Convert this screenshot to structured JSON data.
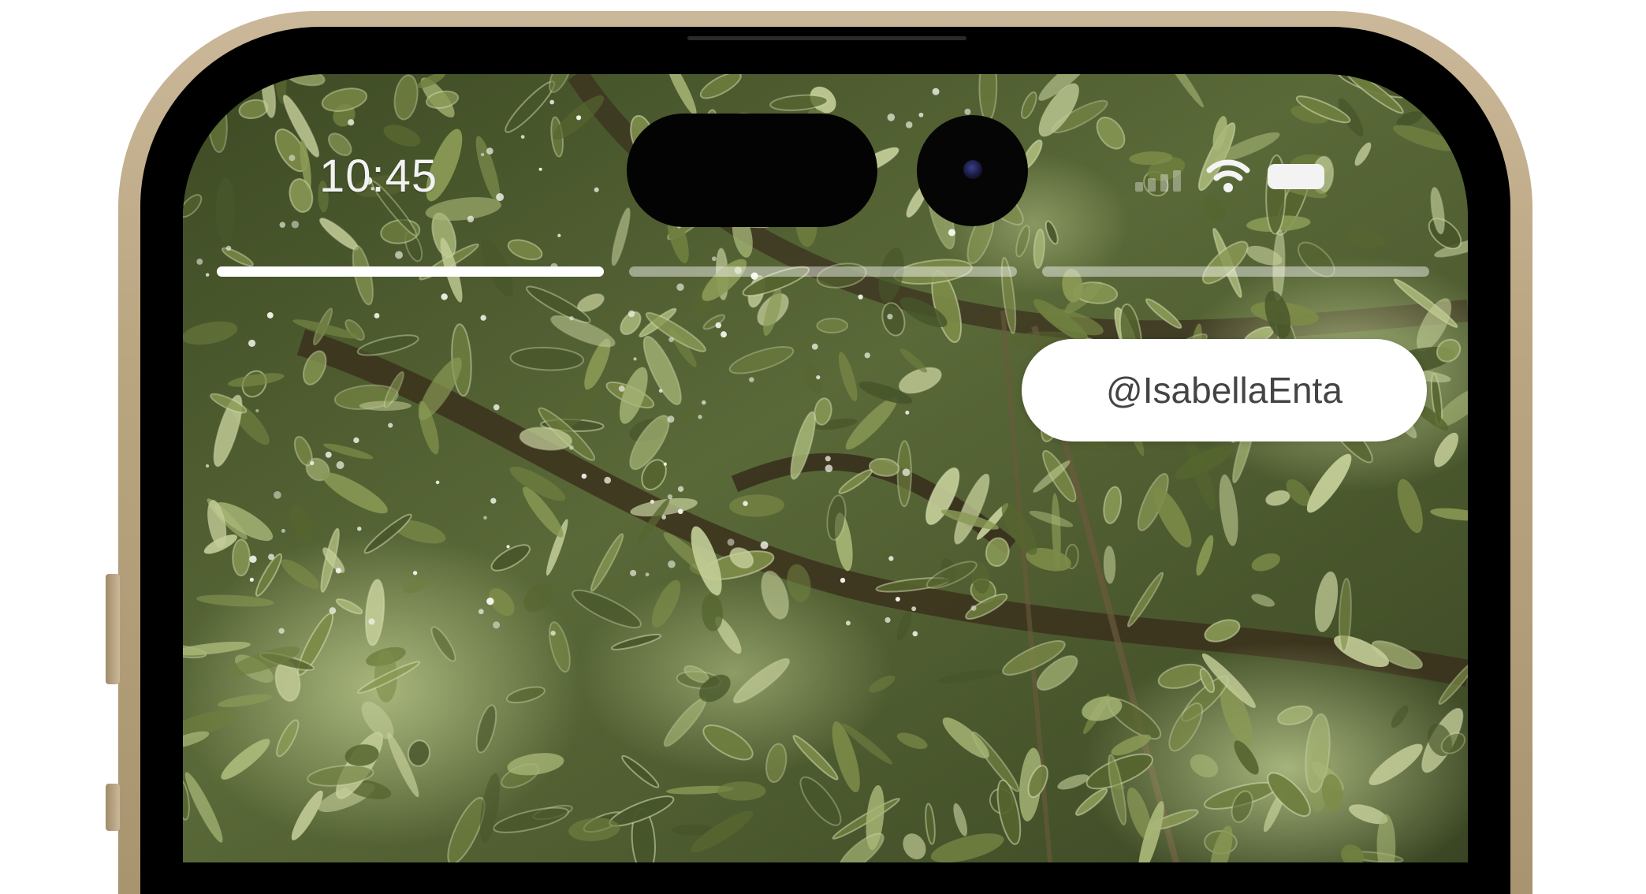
{
  "status_bar": {
    "time": "10:45",
    "signal_icon": "cellular-signal-icon",
    "wifi_icon": "wifi-icon",
    "battery_icon": "battery-icon"
  },
  "story": {
    "progress_segments": [
      {
        "state": "viewed",
        "fill": 1.0
      },
      {
        "state": "upcoming",
        "fill": 0.0
      },
      {
        "state": "upcoming",
        "fill": 0.0
      }
    ],
    "background_image": "foliage-photo",
    "mention_sticker": "@IsabellaEnta"
  },
  "colors": {
    "frame_gold": "#b9a57f",
    "sticker_bg": "#ffffff",
    "sticker_text": "#444444",
    "foliage_dark": "#2f3a1c",
    "foliage_light": "#a9b878"
  }
}
